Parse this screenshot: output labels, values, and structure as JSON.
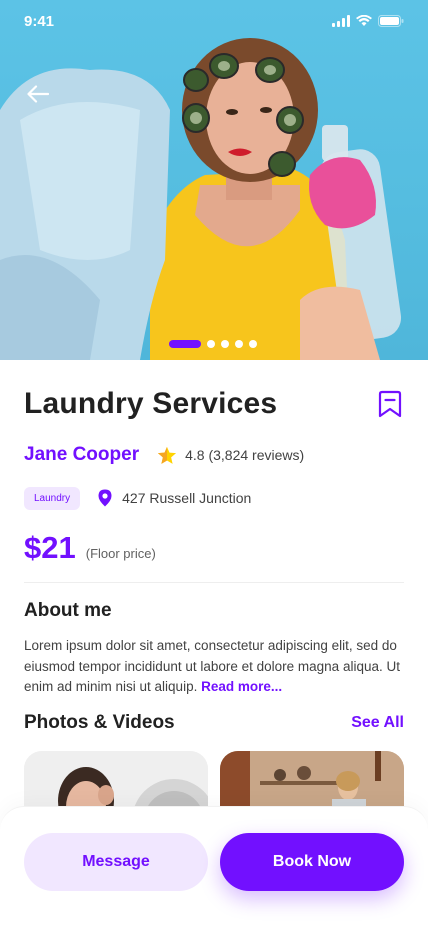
{
  "status_bar": {
    "time": "9:41"
  },
  "hero": {
    "slide_count": 5,
    "active_slide": 1
  },
  "service": {
    "title": "Laundry Services",
    "provider": "Jane Cooper",
    "rating": "4.8 (3,824 reviews)",
    "category_tag": "Laundry",
    "location": "427 Russell Junction",
    "price": "$21",
    "price_note": "(Floor price)"
  },
  "about": {
    "title": "About me",
    "text": "Lorem ipsum dolor sit amet, consectetur adipiscing elit, sed do eiusmod tempor incididunt ut labore et dolore magna aliqua. Ut enim ad minim nisi ut aliquip.",
    "read_more": "Read more..."
  },
  "photos": {
    "title": "Photos & Videos",
    "see_all": "See All"
  },
  "actions": {
    "message_label": "Message",
    "book_label": "Book Now"
  },
  "colors": {
    "accent": "#7210FF",
    "accent_light": "#F1E7FF",
    "star": "#FFD300",
    "hero_bg": "#5CC3E6"
  },
  "icons": [
    "back-arrow-icon",
    "bookmark-icon",
    "star-icon",
    "location-pin-icon",
    "signal-icon",
    "wifi-icon",
    "battery-icon"
  ]
}
